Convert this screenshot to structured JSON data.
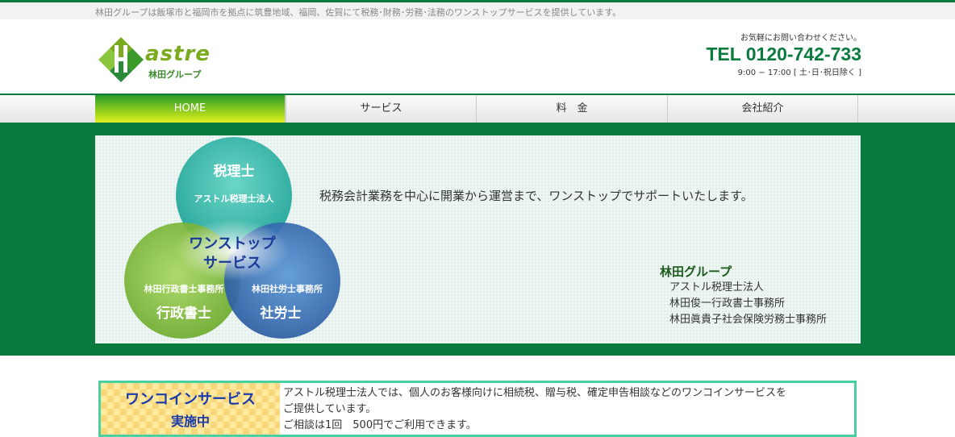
{
  "topbar": {
    "text": "林田グループは飯塚市と福岡市を拠点に筑豊地域、福岡、佐賀にて税務･財務･労務･法務のワンストップサービスを提供しています。"
  },
  "logo": {
    "word": "astre",
    "sub": "林田グループ"
  },
  "contact": {
    "note": "お気軽にお問い合わせください。",
    "tel": "TEL 0120-742-733",
    "hours": "9:00 − 17:00 [ 土･日･祝日除く ]"
  },
  "nav": {
    "items": [
      {
        "label": "HOME",
        "active": true
      },
      {
        "label": "サービス"
      },
      {
        "label": "料　金"
      },
      {
        "label": "会社紹介"
      }
    ]
  },
  "hero": {
    "venn": {
      "top_title": "税理士",
      "top_sub": "アストル税理士法人",
      "center_1": "ワンストップ",
      "center_2": "サービス",
      "left_sub": "林田行政書士事務所",
      "left_title": "行政書士",
      "right_sub": "林田社労士事務所",
      "right_title": "社労士",
      "colors": {
        "top": "#3cbfb3",
        "left": "#8cc63f",
        "right": "#3a78c0",
        "center_text": "#1a3a9a"
      }
    },
    "lead": "税務会計業務を中心に開業から運営まで、ワンストップでサポートいたします。",
    "group": {
      "title": "林田グループ",
      "members": [
        "アストル税理士法人",
        "林田俊一行政書士事務所",
        "林田眞貴子社会保険労務士事務所"
      ]
    }
  },
  "promo": {
    "title": "ワンコインサービス",
    "sub": "実施中",
    "lines": [
      "アストル税理士法人では、個人のお客様向けに相続税、贈与税、確定申告相談などのワンコインサービスを",
      "ご提供しています。",
      "ご相談は1回　500円でご利用できます。"
    ]
  },
  "colors": {
    "brand_green": "#0a7a3e",
    "accent_lime": "#a8d81a"
  }
}
